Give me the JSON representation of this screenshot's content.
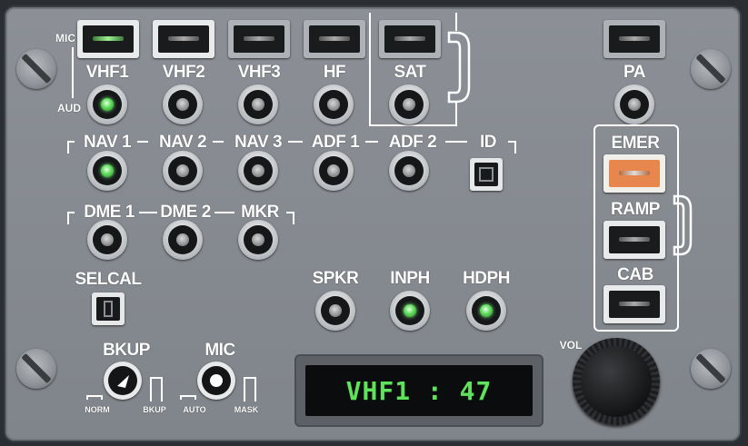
{
  "labels": {
    "mic": "MIC",
    "aud": "AUD",
    "vhf1": "VHF1",
    "vhf2": "VHF2",
    "vhf3": "VHF3",
    "hf": "HF",
    "sat": "SAT",
    "pa": "PA",
    "nav1": "NAV 1",
    "nav2": "NAV 2",
    "nav3": "NAV 3",
    "adf1": "ADF 1",
    "adf2": "ADF 2",
    "id": "ID",
    "emer": "EMER",
    "ramp": "RAMP",
    "cab": "CAB",
    "dme1": "DME 1",
    "dme2": "DME 2",
    "mkr": "MKR",
    "selcal": "SELCAL",
    "spkr": "SPKR",
    "inph": "INPH",
    "hdph": "HDPH",
    "bkup": "BKUP",
    "mic_selector": "MIC",
    "norm": "NORM",
    "bkup_pos": "BKUP",
    "auto": "AUTO",
    "mask": "MASK",
    "vol": "VOL"
  },
  "display": {
    "text": "VHF1 : 47"
  },
  "state": {
    "mic_vhf1_selected": true,
    "vhf1_audio_on": true,
    "nav1_audio_on": true,
    "inph_on": true,
    "hdph_on": true
  },
  "colors": {
    "led_green": "#5ddb5a",
    "display_green": "#5fe35a",
    "emer_orange": "#e8874d",
    "panel_gray": "#878b91"
  }
}
